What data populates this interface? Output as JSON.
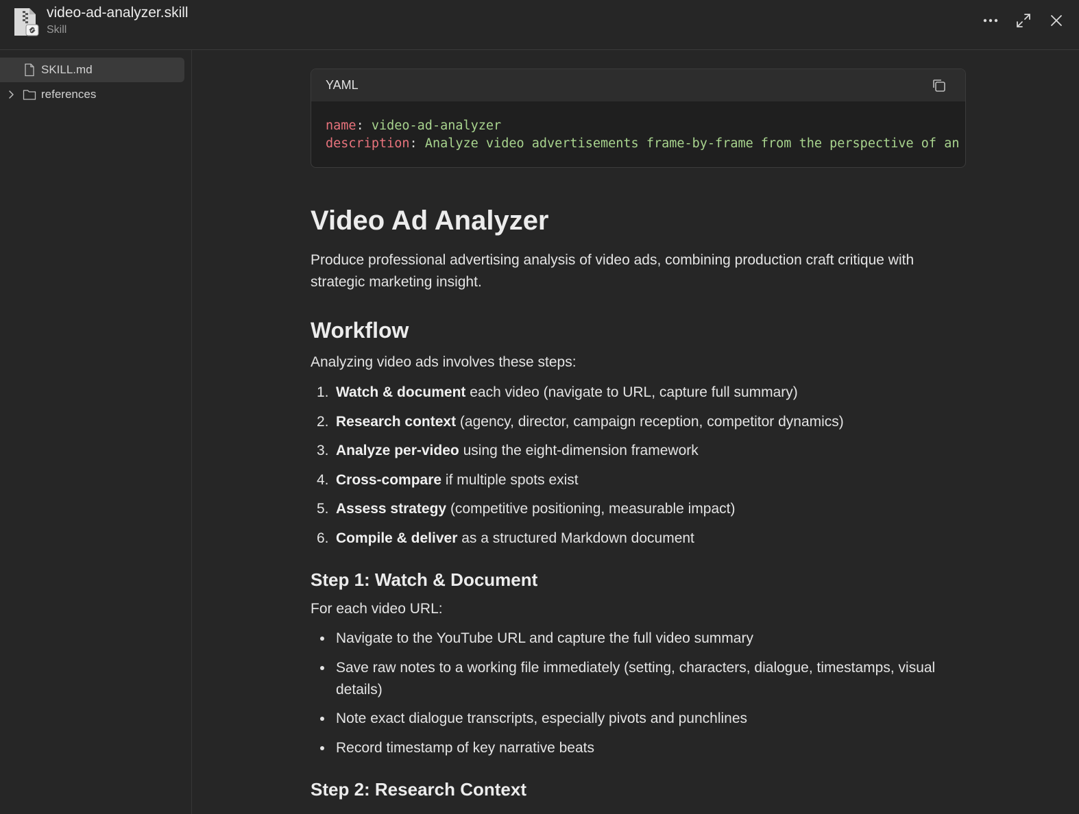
{
  "header": {
    "title": "video-ad-analyzer.skill",
    "subtitle": "Skill",
    "file_icon": "zip-file-icon",
    "more_icon": "more-horizontal-icon",
    "expand_icon": "expand-icon",
    "close_icon": "close-icon"
  },
  "sidebar": {
    "items": [
      {
        "label": "SKILL.md",
        "icon": "file-icon",
        "selected": true
      },
      {
        "label": "references",
        "icon": "folder-icon",
        "expandable": true
      }
    ]
  },
  "code": {
    "language": "YAML",
    "copy_icon": "copy-icon",
    "line1_key": "name",
    "line1_value": "video-ad-analyzer",
    "line2_key": "description",
    "line2_value": "Analyze video advertisements frame-by-frame from the perspective of an"
  },
  "doc": {
    "title": "Video Ad Analyzer",
    "intro": "Produce professional advertising analysis of video ads, combining production craft critique with strategic marketing insight.",
    "workflow_heading": "Workflow",
    "workflow_intro": "Analyzing video ads involves these steps:",
    "steps": [
      {
        "num": "1.",
        "bold": "Watch & document",
        "rest": " each video (navigate to URL, capture full summary)"
      },
      {
        "num": "2.",
        "bold": "Research context",
        "rest": " (agency, director, campaign reception, competitor dynamics)"
      },
      {
        "num": "3.",
        "bold": "Analyze per-video",
        "rest": " using the eight-dimension framework"
      },
      {
        "num": "4.",
        "bold": "Cross-compare",
        "rest": " if multiple spots exist"
      },
      {
        "num": "5.",
        "bold": "Assess strategy",
        "rest": " (competitive positioning, measurable impact)"
      },
      {
        "num": "6.",
        "bold": "Compile & deliver",
        "rest": " as a structured Markdown document"
      }
    ],
    "step1_heading": "Step 1: Watch & Document",
    "step1_intro": "For each video URL:",
    "step1_bullets": [
      "Navigate to the YouTube URL and capture the full video summary",
      "Save raw notes to a working file immediately (setting, characters, dialogue, timestamps, visual details)",
      "Note exact dialogue transcripts, especially pivots and punchlines",
      "Record timestamp of key narrative beats"
    ],
    "step2_heading": "Step 2: Research Context"
  }
}
